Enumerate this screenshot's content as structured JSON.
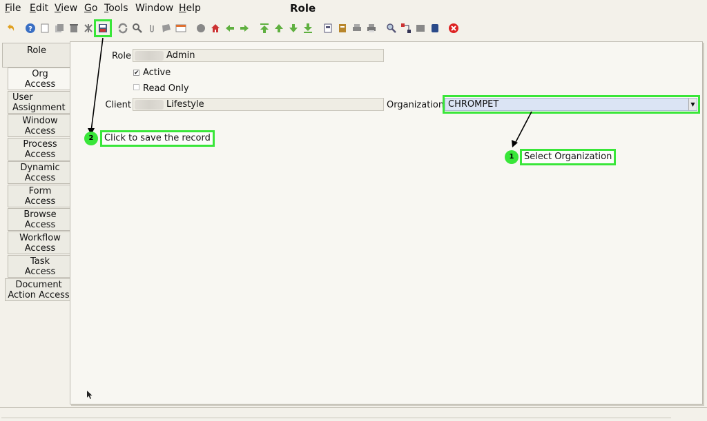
{
  "window": {
    "title": "Role"
  },
  "menu": [
    {
      "label": "File",
      "key": "F",
      "rest": "ile"
    },
    {
      "label": "Edit",
      "key": "E",
      "rest": "dit"
    },
    {
      "label": "View",
      "key": "V",
      "rest": "iew"
    },
    {
      "label": "Go",
      "key": "G",
      "rest": "o"
    },
    {
      "label": "Tools",
      "key": "T",
      "rest": "ools"
    },
    {
      "label": "Window",
      "key": "",
      "rest": "Window"
    },
    {
      "label": "Help",
      "key": "H",
      "rest": "elp"
    }
  ],
  "tabs": [
    "Role",
    "Org\nAccess",
    "User\nAssignment",
    "Window\nAccess",
    "Process\nAccess",
    "Dynamic\nAccess",
    "Form\nAccess",
    "Browse\nAccess",
    "Workflow\nAccess",
    "Task\nAccess",
    "Document\nAction Access"
  ],
  "form": {
    "role_label": "Role",
    "role_value": "Admin",
    "active_label": "Active",
    "active_checked": true,
    "readonly_label": "Read Only",
    "readonly_checked": false,
    "client_label": "Client",
    "client_value": "Lifestyle",
    "org_label": "Organization",
    "org_value": "CHROMPET"
  },
  "annotations": {
    "step1_number": "1",
    "step1_text": "Select Organization",
    "step2_number": "2",
    "step2_text": "Click to save the record",
    "highlight_color": "#39e639"
  }
}
